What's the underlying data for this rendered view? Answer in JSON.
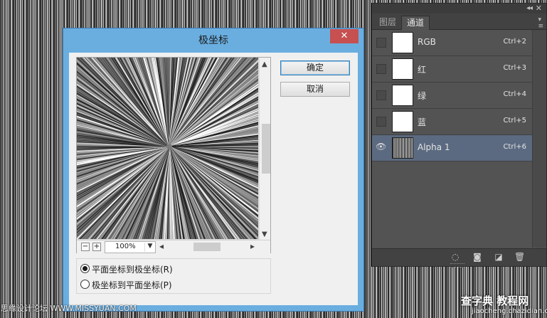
{
  "panel": {
    "tabs": [
      {
        "label": "图层",
        "active": false
      },
      {
        "label": "通道",
        "active": true
      }
    ],
    "channels": [
      {
        "name": "RGB",
        "shortcut": "Ctrl+2",
        "visible": false,
        "selected": false
      },
      {
        "name": "红",
        "shortcut": "Ctrl+3",
        "visible": false,
        "selected": false
      },
      {
        "name": "绿",
        "shortcut": "Ctrl+4",
        "visible": false,
        "selected": false
      },
      {
        "name": "蓝",
        "shortcut": "Ctrl+5",
        "visible": false,
        "selected": false
      },
      {
        "name": "Alpha 1",
        "shortcut": "Ctrl+6",
        "visible": true,
        "selected": true
      }
    ],
    "icons": [
      "dotted-selection-icon",
      "mask-icon",
      "new-channel-icon",
      "trash-icon"
    ]
  },
  "dialog": {
    "title": "极坐标",
    "close_symbol": "✕",
    "ok_label": "确定",
    "cancel_label": "取消",
    "zoom_value": "100%",
    "options": [
      {
        "label": "平面坐标到极坐标(R)",
        "checked": true
      },
      {
        "label": "极坐标到平面坐标(P)",
        "checked": false
      }
    ]
  },
  "watermarks": {
    "left": "思缘设计论坛 WWW.MISSYUAN.COM",
    "right_top": "查字典 教程网",
    "right_bottom": "jiaocheng.chazidian.com"
  },
  "colors": {
    "dialog_frame": "#6aaee0",
    "close_button": "#c75050",
    "panel_bg": "#535353",
    "selected_row": "#5b6a80"
  }
}
